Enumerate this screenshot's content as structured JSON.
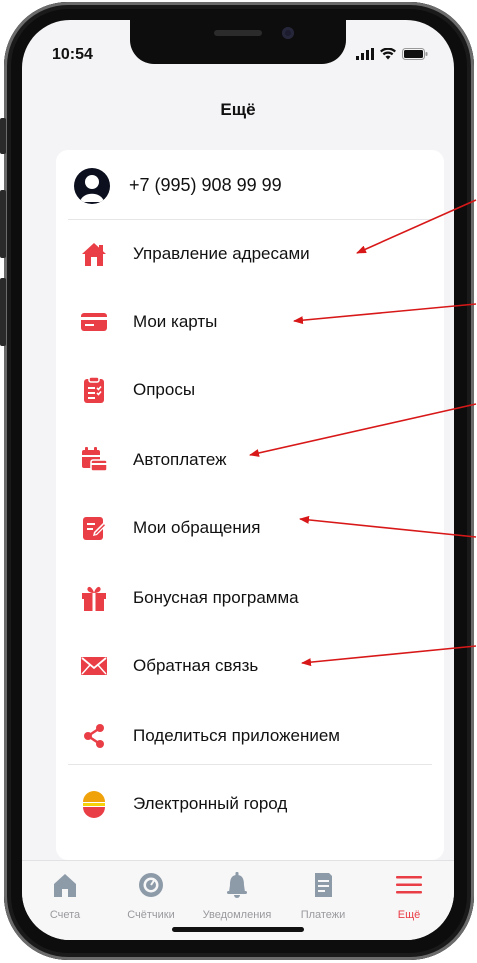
{
  "status_bar": {
    "time": "10:54"
  },
  "header": {
    "title": "Ещё"
  },
  "profile": {
    "phone": "+7 (995) 908 99 99"
  },
  "menu": {
    "items": [
      {
        "label": "Управление адресами",
        "icon": "home-icon"
      },
      {
        "label": "Мои карты",
        "icon": "card-icon"
      },
      {
        "label": "Опросы",
        "icon": "clipboard-icon"
      },
      {
        "label": "Автоплатеж",
        "icon": "calendar-card-icon"
      },
      {
        "label": "Мои обращения",
        "icon": "edit-note-icon"
      },
      {
        "label": "Бонусная программа",
        "icon": "gift-icon"
      },
      {
        "label": "Обратная связь",
        "icon": "envelope-icon"
      },
      {
        "label": "Поделиться приложением",
        "icon": "share-icon"
      },
      {
        "label": "Электронный город",
        "icon": "city-logo-icon"
      }
    ]
  },
  "tabbar": {
    "tabs": [
      {
        "label": "Счета",
        "icon": "house-tab-icon",
        "active": false
      },
      {
        "label": "Счётчики",
        "icon": "meter-tab-icon",
        "active": false
      },
      {
        "label": "Уведомления",
        "icon": "bell-tab-icon",
        "active": false
      },
      {
        "label": "Платежи",
        "icon": "receipt-tab-icon",
        "active": false
      },
      {
        "label": "Ещё",
        "icon": "menu-tab-icon",
        "active": true
      }
    ]
  },
  "colors": {
    "accent": "#ea3e46",
    "annotation_arrow": "#d81818",
    "tab_inactive": "#8d9aa8"
  }
}
